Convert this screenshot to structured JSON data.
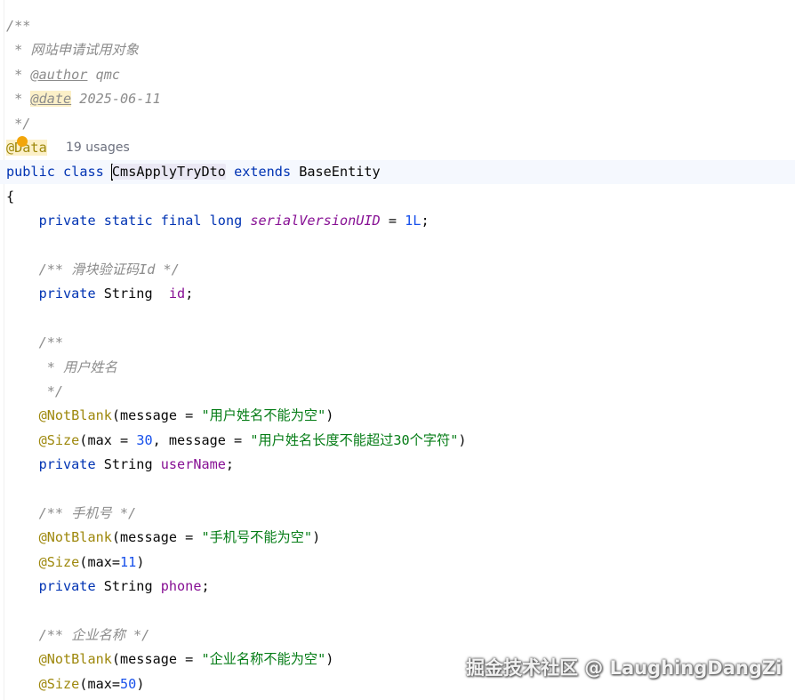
{
  "file_lines": [
    [
      {
        "t": "/**",
        "c": "comment"
      }
    ],
    [
      {
        "t": " * 网站申请试用对象",
        "c": "comment"
      }
    ],
    [
      {
        "t": " * ",
        "c": "comment"
      },
      {
        "t": "@author",
        "c": "doctag"
      },
      {
        "t": " qmc",
        "c": "comment"
      }
    ],
    [
      {
        "t": " * ",
        "c": "comment"
      },
      {
        "t": "@date",
        "c": "doctag hl"
      },
      {
        "t": " 2025-06-11",
        "c": "comment"
      }
    ],
    [
      {
        "t": " */",
        "c": "comment"
      }
    ],
    [
      {
        "t": "@Data",
        "c": "data-anno"
      }
    ],
    [
      {
        "t": "public",
        "c": "kw"
      },
      {
        "t": " ",
        "c": "plain"
      },
      {
        "t": "class",
        "c": "kw"
      },
      {
        "t": " ",
        "c": "plain"
      },
      {
        "t": "CmsApplyTryDto",
        "c": "plain class-hl",
        "caret": true
      },
      {
        "t": " ",
        "c": "plain"
      },
      {
        "t": "extends",
        "c": "kw"
      },
      {
        "t": " BaseEntity",
        "c": "plain"
      }
    ],
    [
      {
        "t": "{",
        "c": "plain"
      }
    ],
    [
      {
        "t": "    ",
        "c": "plain"
      },
      {
        "t": "private",
        "c": "kw"
      },
      {
        "t": " ",
        "c": "plain"
      },
      {
        "t": "static",
        "c": "kw"
      },
      {
        "t": " ",
        "c": "plain"
      },
      {
        "t": "final",
        "c": "kw"
      },
      {
        "t": " ",
        "c": "plain"
      },
      {
        "t": "long",
        "c": "kw"
      },
      {
        "t": " ",
        "c": "plain"
      },
      {
        "t": "serialVersionUID",
        "c": "static-field"
      },
      {
        "t": " = ",
        "c": "plain"
      },
      {
        "t": "1L",
        "c": "num"
      },
      {
        "t": ";",
        "c": "plain"
      }
    ],
    [],
    [
      {
        "t": "    /** 滑块验证码Id */",
        "c": "comment"
      }
    ],
    [
      {
        "t": "    ",
        "c": "plain"
      },
      {
        "t": "private",
        "c": "kw"
      },
      {
        "t": " String  ",
        "c": "plain"
      },
      {
        "t": "id",
        "c": "field"
      },
      {
        "t": ";",
        "c": "plain"
      }
    ],
    [],
    [
      {
        "t": "    /**",
        "c": "comment"
      }
    ],
    [
      {
        "t": "     * 用户姓名",
        "c": "comment"
      }
    ],
    [
      {
        "t": "     */",
        "c": "comment"
      }
    ],
    [
      {
        "t": "    ",
        "c": "plain"
      },
      {
        "t": "@NotBlank",
        "c": "anno"
      },
      {
        "t": "(message = ",
        "c": "plain"
      },
      {
        "t": "\"用户姓名不能为空\"",
        "c": "str"
      },
      {
        "t": ")",
        "c": "plain"
      }
    ],
    [
      {
        "t": "    ",
        "c": "plain"
      },
      {
        "t": "@Size",
        "c": "anno"
      },
      {
        "t": "(max = ",
        "c": "plain"
      },
      {
        "t": "30",
        "c": "num"
      },
      {
        "t": ", message = ",
        "c": "plain"
      },
      {
        "t": "\"用户姓名长度不能超过30个字符\"",
        "c": "str"
      },
      {
        "t": ")",
        "c": "plain"
      }
    ],
    [
      {
        "t": "    ",
        "c": "plain"
      },
      {
        "t": "private",
        "c": "kw"
      },
      {
        "t": " String ",
        "c": "plain"
      },
      {
        "t": "userName",
        "c": "field"
      },
      {
        "t": ";",
        "c": "plain"
      }
    ],
    [],
    [
      {
        "t": "    /** 手机号 */",
        "c": "comment"
      }
    ],
    [
      {
        "t": "    ",
        "c": "plain"
      },
      {
        "t": "@NotBlank",
        "c": "anno"
      },
      {
        "t": "(message = ",
        "c": "plain"
      },
      {
        "t": "\"手机号不能为空\"",
        "c": "str"
      },
      {
        "t": ")",
        "c": "plain"
      }
    ],
    [
      {
        "t": "    ",
        "c": "plain"
      },
      {
        "t": "@Size",
        "c": "anno"
      },
      {
        "t": "(max=",
        "c": "plain"
      },
      {
        "t": "11",
        "c": "num"
      },
      {
        "t": ")",
        "c": "plain"
      }
    ],
    [
      {
        "t": "    ",
        "c": "plain"
      },
      {
        "t": "private",
        "c": "kw"
      },
      {
        "t": " String ",
        "c": "plain"
      },
      {
        "t": "phone",
        "c": "field"
      },
      {
        "t": ";",
        "c": "plain"
      }
    ],
    [],
    [
      {
        "t": "    /** 企业名称 */",
        "c": "comment"
      }
    ],
    [
      {
        "t": "    ",
        "c": "plain"
      },
      {
        "t": "@NotBlank",
        "c": "anno"
      },
      {
        "t": "(message = ",
        "c": "plain"
      },
      {
        "t": "\"企业名称不能为空\"",
        "c": "str"
      },
      {
        "t": ")",
        "c": "plain"
      }
    ],
    [
      {
        "t": "    ",
        "c": "plain"
      },
      {
        "t": "@Size",
        "c": "anno"
      },
      {
        "t": "(max=",
        "c": "plain"
      },
      {
        "t": "50",
        "c": "num"
      },
      {
        "t": ")",
        "c": "plain"
      }
    ]
  ],
  "usages_hint": "19 usages",
  "current_line_index": 6,
  "watermark": "掘金技术社区 @ LaughingDangZi",
  "colors": {
    "keyword": "#0033b3",
    "field": "#871094",
    "number": "#1750eb",
    "string": "#067d17",
    "annotation": "#9e880d",
    "comment": "#8c8c8c",
    "current_line": "#f5f8fe"
  }
}
